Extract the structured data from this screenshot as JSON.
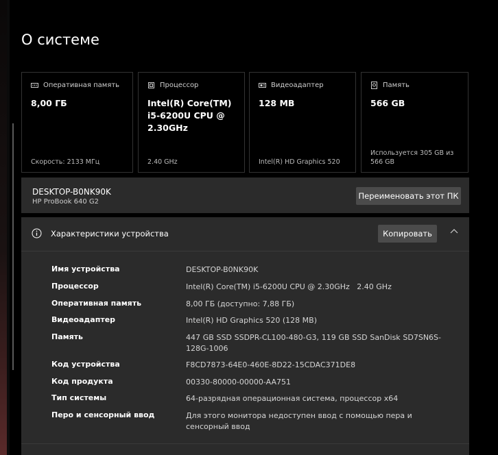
{
  "page": {
    "title": "О системе"
  },
  "cards": [
    {
      "icon": "memory-icon",
      "label": "Оперативная память",
      "value": "8,00 ГБ",
      "footer": "Скорость: 2133 МГц"
    },
    {
      "icon": "processor-icon",
      "label": "Процессор",
      "value": "Intel(R) Core(TM) i5-6200U CPU @ 2.30GHz",
      "footer": "2.40 GHz"
    },
    {
      "icon": "display-adapter-icon",
      "label": "Видеоадаптер",
      "value": "128 MB",
      "footer": "Intel(R) HD Graphics 520"
    },
    {
      "icon": "storage-icon",
      "label": "Память",
      "value": "566 GB",
      "footer": "Используется 305 GB из 566 GB"
    }
  ],
  "device": {
    "name": "DESKTOP-B0NK90K",
    "model": "HP ProBook 640 G2",
    "rename_label": "Переименовать этот ПК"
  },
  "specs": {
    "title": "Характеристики устройства",
    "copy_label": "Копировать",
    "rows": [
      {
        "key": "Имя устройства",
        "value": "DESKTOP-B0NK90K"
      },
      {
        "key": "Процессор",
        "value": "Intel(R) Core(TM) i5-6200U CPU @ 2.30GHz   2.40 GHz"
      },
      {
        "key": "Оперативная память",
        "value": "8,00 ГБ (доступно: 7,88 ГБ)"
      },
      {
        "key": "Видеоадаптер",
        "value": "Intel(R) HD Graphics 520 (128 MB)"
      },
      {
        "key": "Память",
        "value": "447 GB SSD SSDPR-CL100-480-G3, 119 GB SSD SanDisk SD7SN6S-128G-1006"
      },
      {
        "key": "Код устройства",
        "value": "F8CD7873-64E0-460E-8D22-15CDAC371DE8"
      },
      {
        "key": "Код продукта",
        "value": "00330-80000-00000-AA751"
      },
      {
        "key": "Тип системы",
        "value": "64-разрядная операционная система, процессор x64"
      },
      {
        "key": "Перо и сенсорный ввод",
        "value": "Для этого монитора недоступен ввод с помощью пера и сенсорный ввод"
      }
    ]
  },
  "colors": {
    "background": "#000000",
    "panel": "#2b2b2b",
    "button": "#4b4b4b",
    "text": "#ffffff",
    "muted": "#cfcfcf"
  }
}
